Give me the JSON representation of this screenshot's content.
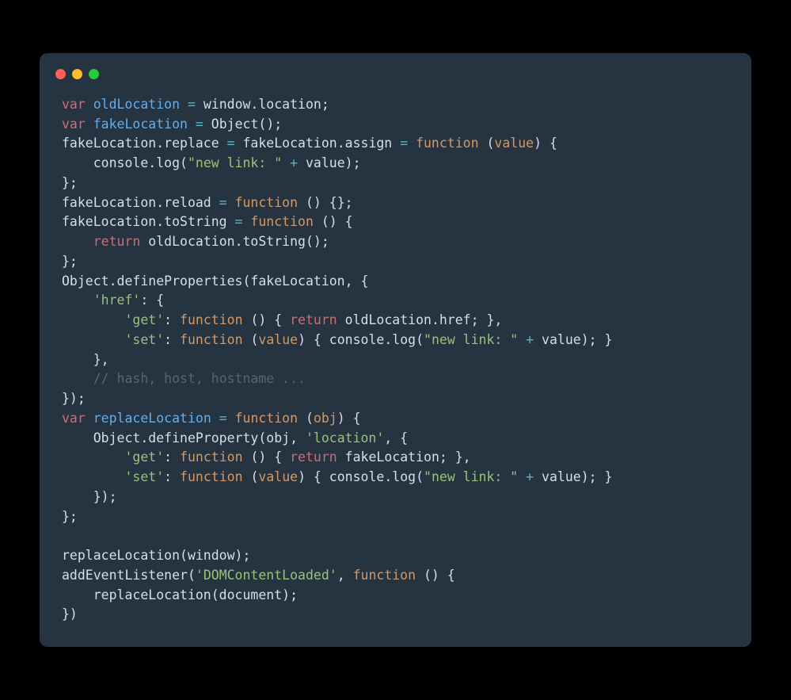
{
  "window": {
    "dots": [
      "#ff5f56",
      "#ffbd2e",
      "#27c93f"
    ]
  },
  "code": {
    "language": "javascript",
    "lines": [
      [
        [
          "kw",
          "var"
        ],
        [
          "pun",
          " "
        ],
        [
          "decl",
          "oldLocation"
        ],
        [
          "pun",
          " "
        ],
        [
          "op",
          "="
        ],
        [
          "pun",
          " window.location;"
        ]
      ],
      [
        [
          "kw",
          "var"
        ],
        [
          "pun",
          " "
        ],
        [
          "decl",
          "fakeLocation"
        ],
        [
          "pun",
          " "
        ],
        [
          "op",
          "="
        ],
        [
          "pun",
          " Object();"
        ]
      ],
      [
        [
          "pun",
          "fakeLocation.replace "
        ],
        [
          "op",
          "="
        ],
        [
          "pun",
          " fakeLocation.assign "
        ],
        [
          "op",
          "="
        ],
        [
          "pun",
          " "
        ],
        [
          "fn",
          "function"
        ],
        [
          "pun",
          " ("
        ],
        [
          "prm",
          "value"
        ],
        [
          "pun",
          ") {"
        ]
      ],
      [
        [
          "pun",
          "    console.log("
        ],
        [
          "str",
          "\"new link: \""
        ],
        [
          "pun",
          " "
        ],
        [
          "op",
          "+"
        ],
        [
          "pun",
          " value);"
        ]
      ],
      [
        [
          "pun",
          "};"
        ]
      ],
      [
        [
          "pun",
          "fakeLocation.reload "
        ],
        [
          "op",
          "="
        ],
        [
          "pun",
          " "
        ],
        [
          "fn",
          "function"
        ],
        [
          "pun",
          " () {};"
        ]
      ],
      [
        [
          "pun",
          "fakeLocation.toString "
        ],
        [
          "op",
          "="
        ],
        [
          "pun",
          " "
        ],
        [
          "fn",
          "function"
        ],
        [
          "pun",
          " () {"
        ]
      ],
      [
        [
          "pun",
          "    "
        ],
        [
          "kw",
          "return"
        ],
        [
          "pun",
          " oldLocation.toString();"
        ]
      ],
      [
        [
          "pun",
          "};"
        ]
      ],
      [
        [
          "pun",
          "Object.defineProperties(fakeLocation, {"
        ]
      ],
      [
        [
          "pun",
          "    "
        ],
        [
          "str",
          "'href'"
        ],
        [
          "pun",
          ": {"
        ]
      ],
      [
        [
          "pun",
          "        "
        ],
        [
          "str",
          "'get'"
        ],
        [
          "pun",
          ": "
        ],
        [
          "fn",
          "function"
        ],
        [
          "pun",
          " () { "
        ],
        [
          "kw",
          "return"
        ],
        [
          "pun",
          " oldLocation.href; },"
        ]
      ],
      [
        [
          "pun",
          "        "
        ],
        [
          "str",
          "'set'"
        ],
        [
          "pun",
          ": "
        ],
        [
          "fn",
          "function"
        ],
        [
          "pun",
          " ("
        ],
        [
          "prm",
          "value"
        ],
        [
          "pun",
          ") { console.log("
        ],
        [
          "str",
          "\"new link: \""
        ],
        [
          "pun",
          " "
        ],
        [
          "op",
          "+"
        ],
        [
          "pun",
          " value); }"
        ]
      ],
      [
        [
          "pun",
          "    },"
        ]
      ],
      [
        [
          "pun",
          "    "
        ],
        [
          "cmt",
          "// hash, host, hostname ..."
        ]
      ],
      [
        [
          "pun",
          "});"
        ]
      ],
      [
        [
          "kw",
          "var"
        ],
        [
          "pun",
          " "
        ],
        [
          "decl",
          "replaceLocation"
        ],
        [
          "pun",
          " "
        ],
        [
          "op",
          "="
        ],
        [
          "pun",
          " "
        ],
        [
          "fn",
          "function"
        ],
        [
          "pun",
          " ("
        ],
        [
          "prm",
          "obj"
        ],
        [
          "pun",
          ") {"
        ]
      ],
      [
        [
          "pun",
          "    Object.defineProperty(obj, "
        ],
        [
          "str",
          "'location'"
        ],
        [
          "pun",
          ", {"
        ]
      ],
      [
        [
          "pun",
          "        "
        ],
        [
          "str",
          "'get'"
        ],
        [
          "pun",
          ": "
        ],
        [
          "fn",
          "function"
        ],
        [
          "pun",
          " () { "
        ],
        [
          "kw",
          "return"
        ],
        [
          "pun",
          " fakeLocation; },"
        ]
      ],
      [
        [
          "pun",
          "        "
        ],
        [
          "str",
          "'set'"
        ],
        [
          "pun",
          ": "
        ],
        [
          "fn",
          "function"
        ],
        [
          "pun",
          " ("
        ],
        [
          "prm",
          "value"
        ],
        [
          "pun",
          ") { console.log("
        ],
        [
          "str",
          "\"new link: \""
        ],
        [
          "pun",
          " "
        ],
        [
          "op",
          "+"
        ],
        [
          "pun",
          " value); }"
        ]
      ],
      [
        [
          "pun",
          "    });"
        ]
      ],
      [
        [
          "pun",
          "};"
        ]
      ],
      [
        [
          "pun",
          ""
        ]
      ],
      [
        [
          "pun",
          "replaceLocation(window);"
        ]
      ],
      [
        [
          "pun",
          "addEventListener("
        ],
        [
          "str",
          "'DOMContentLoaded'"
        ],
        [
          "pun",
          ", "
        ],
        [
          "fn",
          "function"
        ],
        [
          "pun",
          " () {"
        ]
      ],
      [
        [
          "pun",
          "    replaceLocation(document);"
        ]
      ],
      [
        [
          "pun",
          "})"
        ]
      ]
    ]
  }
}
